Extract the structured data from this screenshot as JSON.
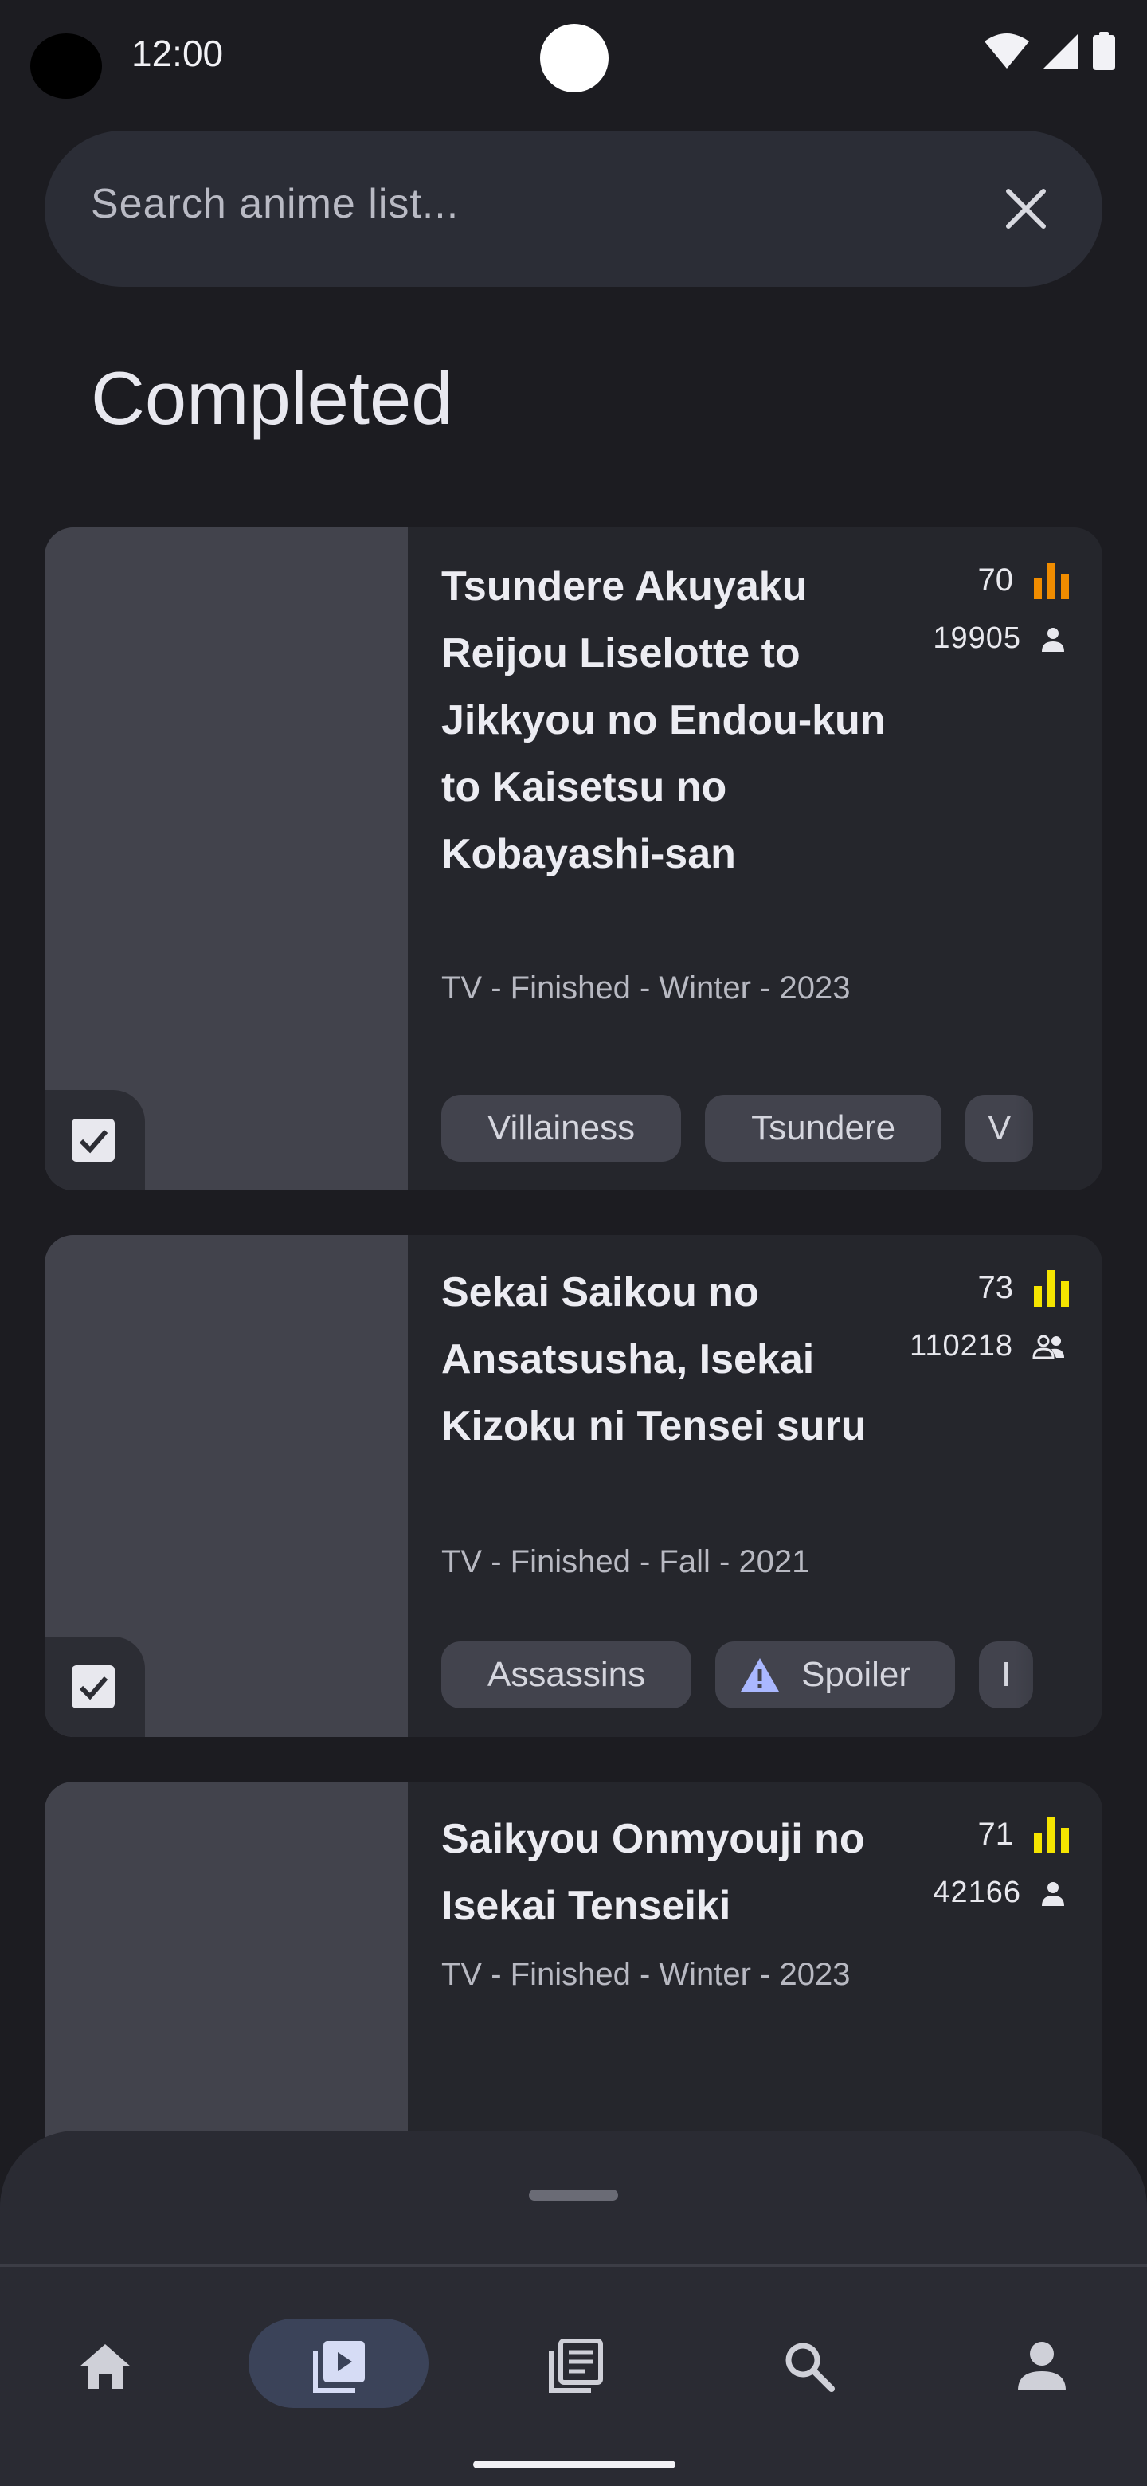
{
  "status_bar": {
    "time": "12:00"
  },
  "search": {
    "placeholder": "Search anime list..."
  },
  "section": {
    "title": "Completed"
  },
  "cards": [
    {
      "title": "Tsundere Akuyaku Reijou Liselotte to Jikkyou no Endou-kun to Kaisetsu no Kobayashi-san",
      "meta": "TV - Finished - Winter - 2023",
      "score": "70",
      "score_color": "#f08c00",
      "members": "19905",
      "members_icon": "person-icon",
      "tags": [
        "Villainess",
        "Tsundere",
        "V"
      ]
    },
    {
      "title": "Sekai Saikou no Ansatsusha, Isekai Kizoku ni Tensei suru",
      "meta": "TV - Finished - Fall - 2021",
      "score": "73",
      "score_color": "#f5e400",
      "members": "110218",
      "members_icon": "people-icon",
      "tags": [
        "Assassins",
        "Spoiler",
        "I"
      ]
    },
    {
      "title": "Saikyou Onmyouji no Isekai Tenseiki",
      "meta": "TV - Finished - Winter - 2023",
      "score": "71",
      "score_color": "#f5e400",
      "members": "42166",
      "members_icon": "person-icon",
      "tags": []
    }
  ],
  "bottom_nav": {
    "items": [
      "home-icon",
      "anime-list-icon",
      "manga-list-icon",
      "search-icon",
      "profile-icon"
    ],
    "active": "anime-list-icon"
  },
  "colors": {
    "background": "#1c1c21",
    "card": "#25262c",
    "accent_pill": "#3b4359"
  }
}
